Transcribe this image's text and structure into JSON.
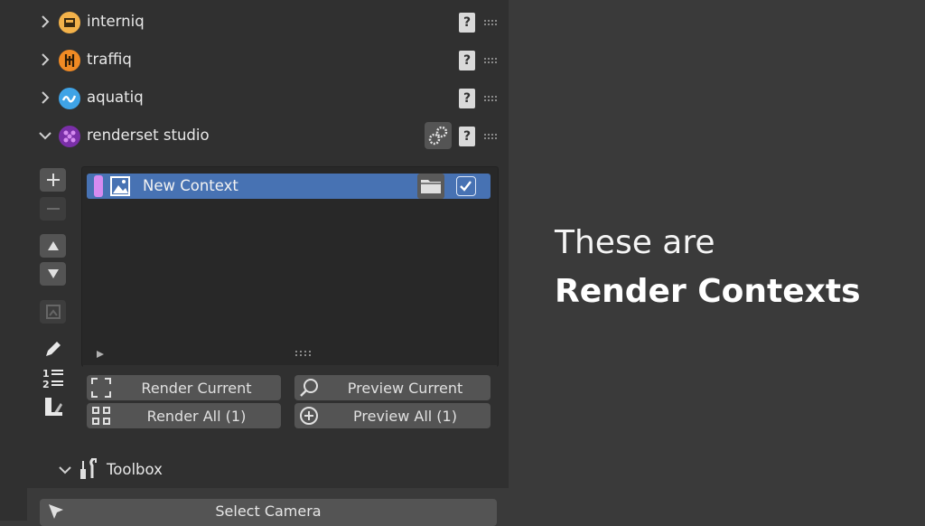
{
  "addons": [
    {
      "label": "interniq",
      "expanded": false,
      "icon": "interniq-logo-icon",
      "color": "#f3b24a"
    },
    {
      "label": "traffiq",
      "expanded": false,
      "icon": "traffiq-logo-icon",
      "color": "#f08a24"
    },
    {
      "label": "aquatiq",
      "expanded": false,
      "icon": "aquatiq-logo-icon",
      "color": "#3fa3e6"
    },
    {
      "label": "renderset studio",
      "expanded": true,
      "icon": "renderset-logo-icon",
      "color": "#9b3fc6"
    }
  ],
  "context_list": {
    "items": [
      {
        "label": "New Context",
        "color": "#d58bf0",
        "enabled": true
      }
    ]
  },
  "buttons": {
    "render_current": "Render Current",
    "preview_current": "Preview Current",
    "render_all": "Render All (1)",
    "preview_all": "Preview All (1)"
  },
  "toolbox": {
    "label": "Toolbox",
    "select_camera": "Select Camera"
  },
  "caption": {
    "line1": "These are",
    "line2": "Render Contexts"
  },
  "colors": {
    "accent": "#4772b3",
    "panel": "#303030",
    "background": "#3a3a3a"
  }
}
